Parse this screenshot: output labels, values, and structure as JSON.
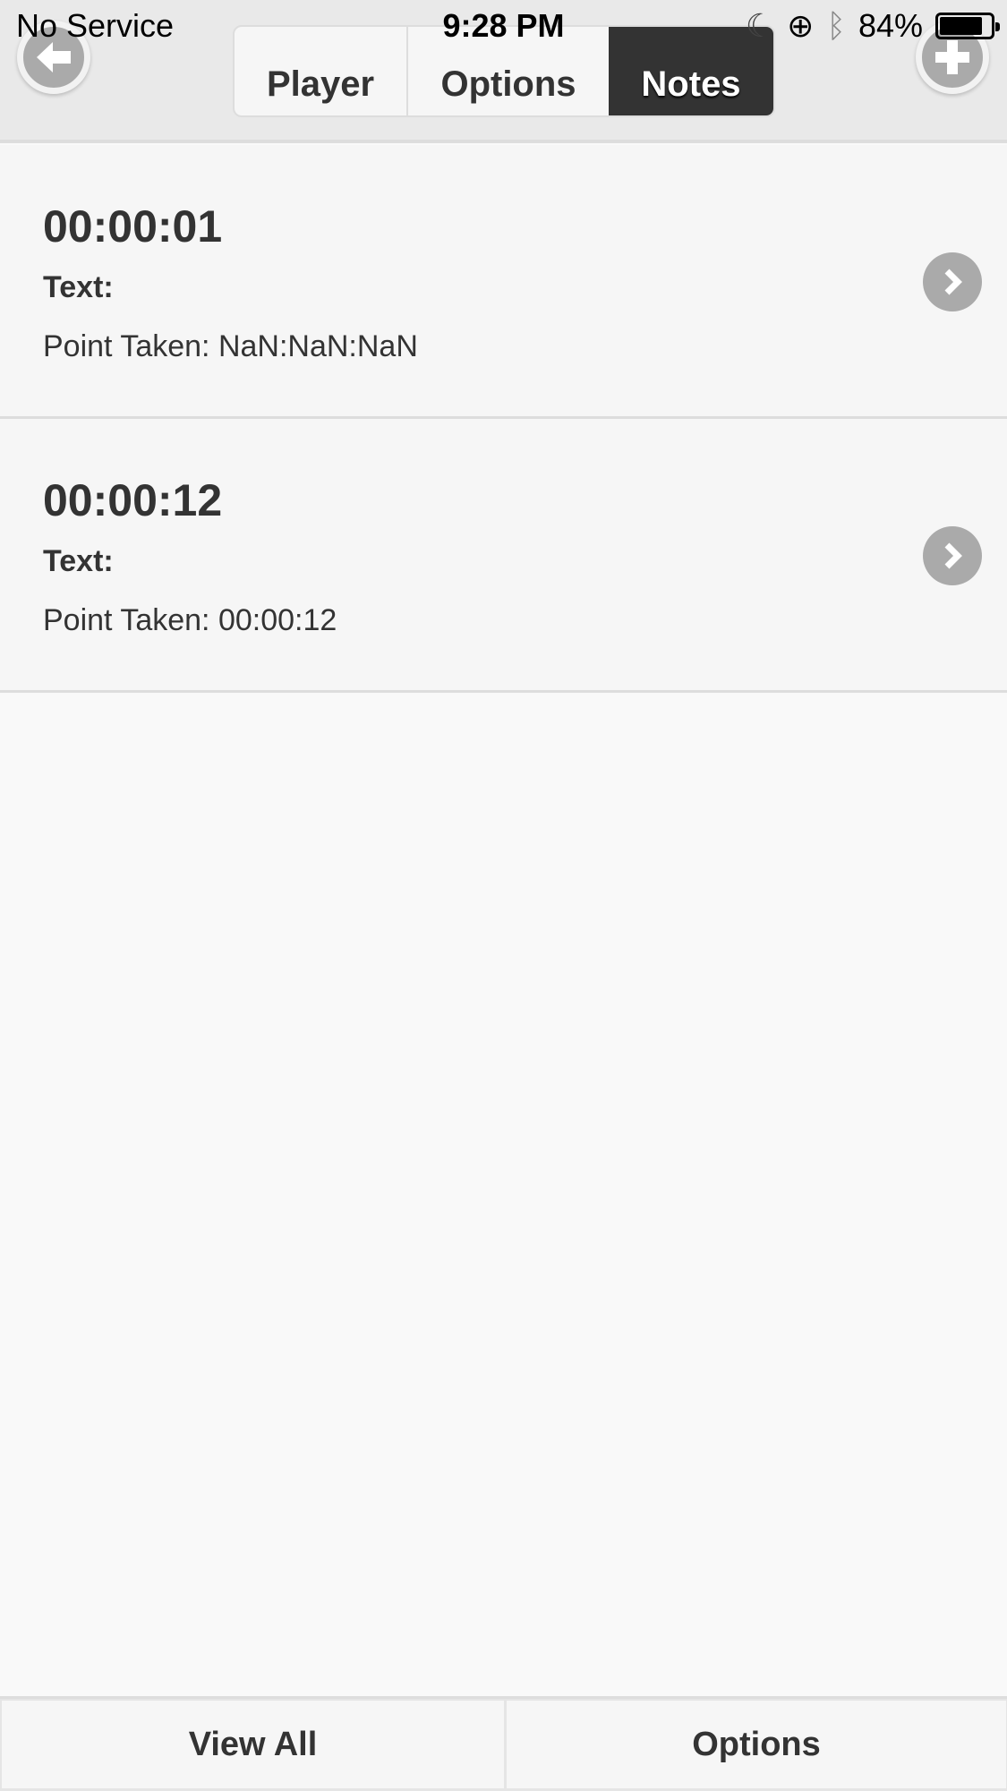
{
  "status_bar": {
    "carrier": "No Service",
    "time": "9:28 PM",
    "battery": "84%",
    "battery_level": 0.84
  },
  "header": {
    "back_icon": "arrow-left-icon",
    "add_icon": "plus-icon",
    "tabs": [
      {
        "label": "Player",
        "active": false
      },
      {
        "label": "Options",
        "active": false
      },
      {
        "label": "Notes",
        "active": true
      }
    ]
  },
  "notes": [
    {
      "time": "00:00:01",
      "text_label": "Text:",
      "point_taken": "Point Taken: NaN:NaN:NaN"
    },
    {
      "time": "00:00:12",
      "text_label": "Text:",
      "point_taken": "Point Taken: 00:00:12"
    }
  ],
  "footer": {
    "view_all": "View All",
    "options": "Options"
  }
}
